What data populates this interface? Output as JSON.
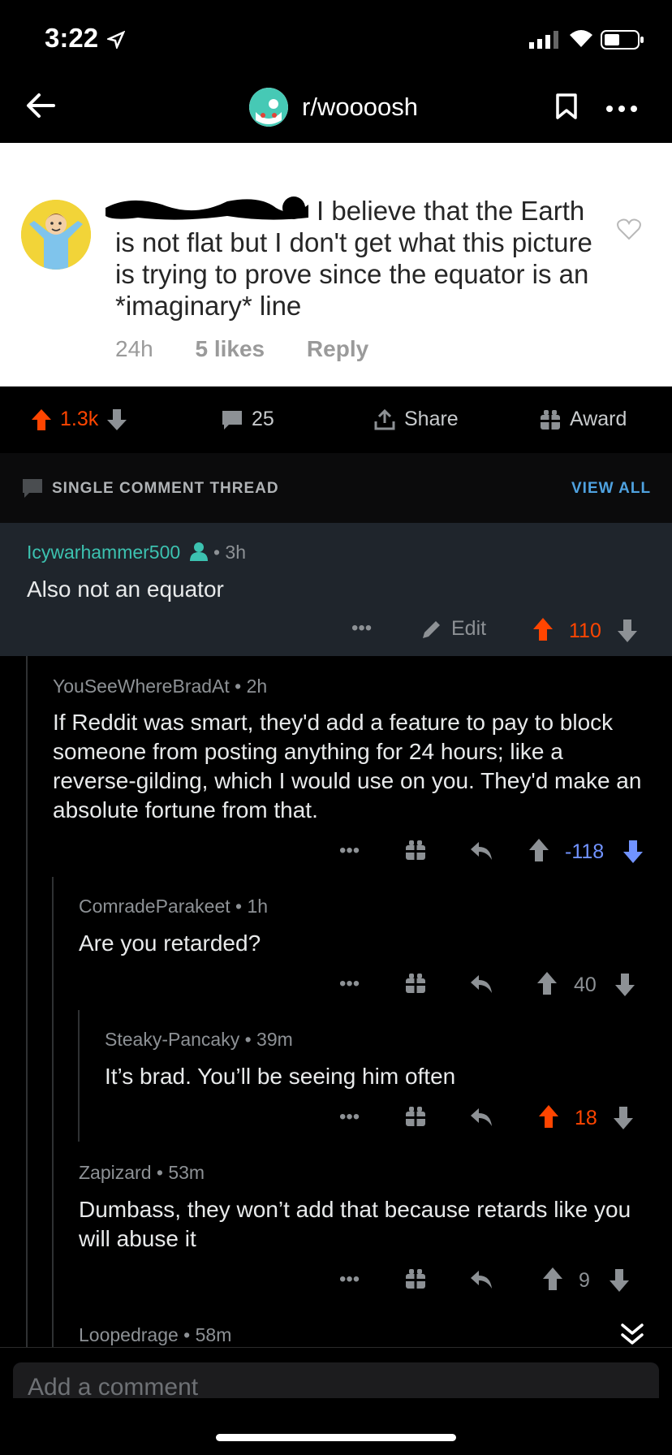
{
  "status_bar": {
    "time": "3:22"
  },
  "nav": {
    "subreddit": "r/woooosh"
  },
  "post_image": {
    "text": "I believe that the Earth is not flat but I don't get what this picture is trying to prove since the equator is an *imaginary* line",
    "meta_time": "24h",
    "meta_likes": "5 likes",
    "meta_reply": "Reply"
  },
  "actions": {
    "votes": "1.3k",
    "comments": "25",
    "share": "Share",
    "award": "Award"
  },
  "thread": {
    "label": "SINGLE COMMENT THREAD",
    "view_all": "VIEW ALL"
  },
  "comments": [
    {
      "author": "Icywarhammer500",
      "time": "3h",
      "body": "Also not an equator",
      "edit": "Edit",
      "score": "110"
    },
    {
      "author": "YouSeeWhereBradAt",
      "time": "2h",
      "body": "If Reddit was smart, they'd add a feature to pay to block someone from posting anything for 24 hours; like a reverse-gilding, which I would use on you. They'd make an absolute fortune from that.",
      "score": "-118"
    },
    {
      "author": "ComradeParakeet",
      "time": "1h",
      "body": "Are you retarded?",
      "score": "40"
    },
    {
      "author": "Steaky-Pancaky",
      "time": "39m",
      "body": "It’s brad. You’ll be seeing him often",
      "score": "18"
    },
    {
      "author": "Zapizard",
      "time": "53m",
      "body": "Dumbass, they won’t add that because retards like you will abuse it",
      "score": "9"
    },
    {
      "author": "Loopedrage",
      "time": "58m"
    }
  ],
  "composer": {
    "placeholder": "Add a comment"
  },
  "colors": {
    "upvote": "#ff4500",
    "downvote": "#7193ff",
    "accent": "#4fa2e0",
    "op": "#3cc2b0"
  }
}
